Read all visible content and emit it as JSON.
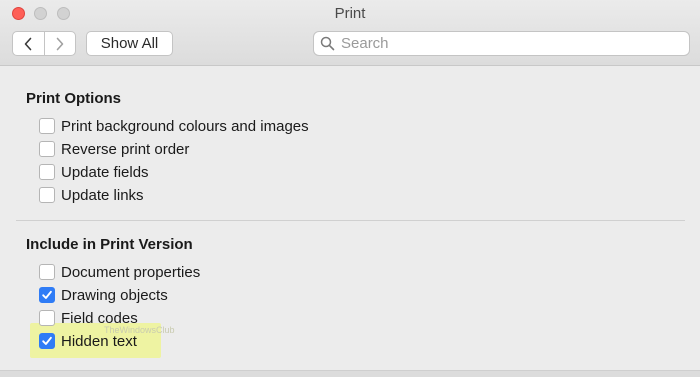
{
  "window": {
    "title": "Print"
  },
  "toolbar": {
    "show_all_label": "Show All",
    "search": {
      "placeholder": "Search",
      "value": ""
    }
  },
  "sections": [
    {
      "title": "Print Options",
      "options": [
        {
          "label": "Print background colours and images",
          "checked": false
        },
        {
          "label": "Reverse print order",
          "checked": false
        },
        {
          "label": "Update fields",
          "checked": false
        },
        {
          "label": "Update links",
          "checked": false
        }
      ]
    },
    {
      "title": "Include in Print Version",
      "options": [
        {
          "label": "Document properties",
          "checked": false
        },
        {
          "label": "Drawing objects",
          "checked": true
        },
        {
          "label": "Field codes",
          "checked": false
        },
        {
          "label": "Hidden text",
          "checked": true
        }
      ]
    }
  ],
  "watermark": "TheWindowsClub",
  "colors": {
    "accent": "#2f7cf6",
    "highlight": "#eef3a2",
    "close": "#fe5f57"
  }
}
